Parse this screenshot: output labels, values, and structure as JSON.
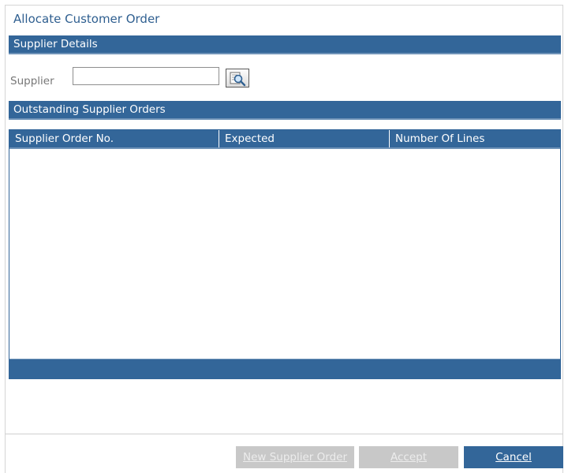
{
  "dialog": {
    "title": "Allocate Customer Order"
  },
  "supplier_details": {
    "header": "Supplier Details",
    "supplier_label": "Supplier",
    "supplier_value": "",
    "lookup_icon": "search-magnifier-icon"
  },
  "outstanding_orders": {
    "header": "Outstanding Supplier Orders",
    "columns": [
      "Supplier Order No.",
      "Expected",
      "Number Of Lines"
    ],
    "rows": []
  },
  "footer": {
    "new_supplier_order_label": "New Supplier Order",
    "accept_label": "Accept",
    "cancel_label": "Cancel"
  },
  "colors": {
    "header_blue": "#336699",
    "title_blue": "#2f5f90",
    "disabled_gray": "#c8c8c8"
  }
}
